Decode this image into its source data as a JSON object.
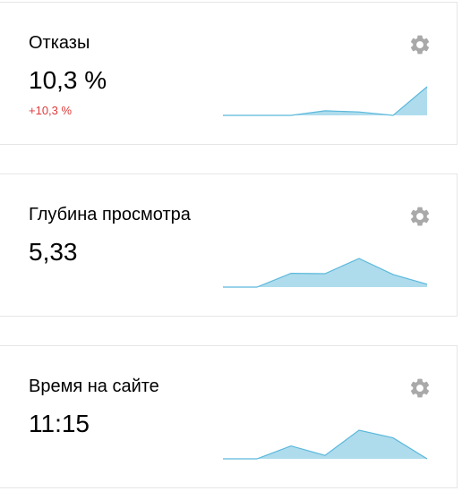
{
  "widgets": [
    {
      "title": "Отказы",
      "value": "10,3 %",
      "delta": "+10,3 %",
      "sparkline": [
        0,
        0,
        0,
        16,
        12,
        0,
        100
      ]
    },
    {
      "title": "Глубина просмотра",
      "value": "5,33",
      "delta": "",
      "sparkline": [
        0,
        0,
        48,
        47,
        100,
        44,
        10
      ]
    },
    {
      "title": "Время на сайте",
      "value": "11:15",
      "delta": "",
      "sparkline": [
        0,
        0,
        45,
        12,
        100,
        73,
        0
      ]
    }
  ],
  "colors": {
    "sparkline_fill": "#aedcec",
    "sparkline_line": "#5bb8dc",
    "gear": "#a9a9a9",
    "delta_negative": "#e03a3a"
  },
  "icons": {
    "settings": "gear-icon"
  }
}
